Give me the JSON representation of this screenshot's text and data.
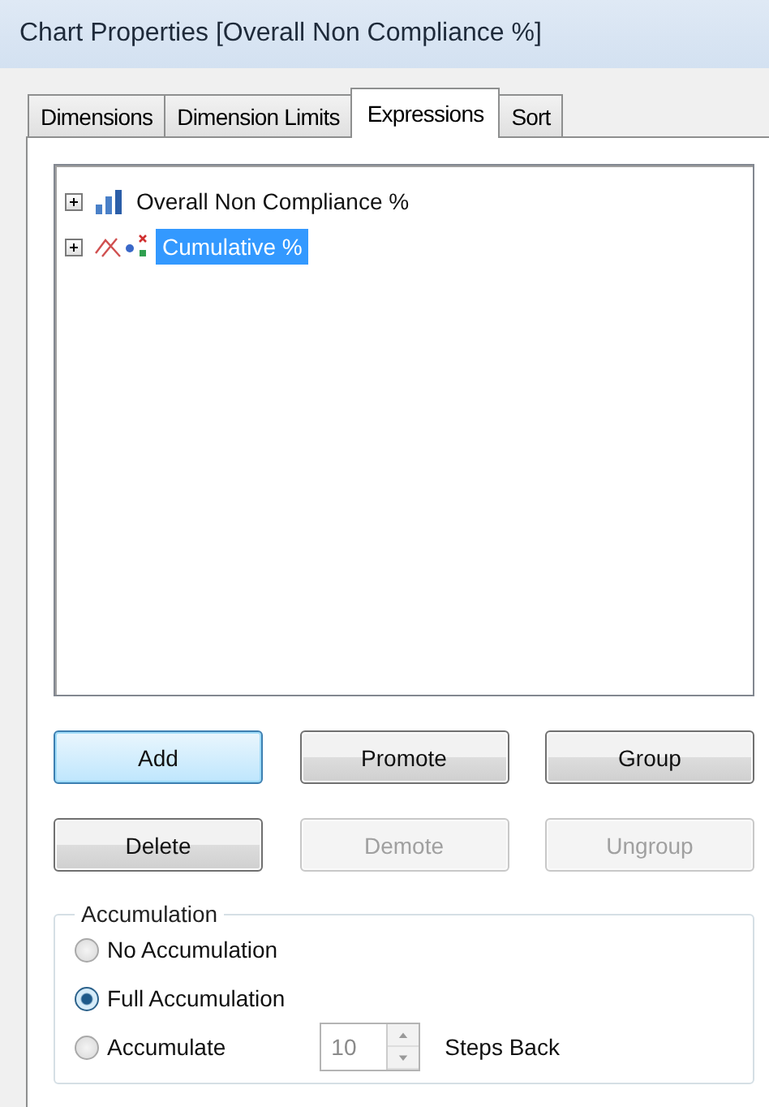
{
  "window": {
    "title": "Chart Properties [Overall Non Compliance %]"
  },
  "tabs": [
    {
      "label": "Dimensions",
      "selected": false
    },
    {
      "label": "Dimension Limits",
      "selected": false
    },
    {
      "label": "Expressions",
      "selected": true
    },
    {
      "label": "Sort",
      "selected": false
    }
  ],
  "expressions": [
    {
      "label": "Overall Non Compliance %",
      "kind": "bar",
      "expanded": false,
      "selected": false
    },
    {
      "label": "Cumulative %",
      "kind": "combo",
      "expanded": false,
      "selected": true
    }
  ],
  "buttons": [
    {
      "label": "Add",
      "disabled": false,
      "focused": true
    },
    {
      "label": "Promote",
      "disabled": false,
      "focused": false
    },
    {
      "label": "Group",
      "disabled": false,
      "focused": false
    },
    {
      "label": "Delete",
      "disabled": false,
      "focused": false
    },
    {
      "label": "Demote",
      "disabled": true,
      "focused": false
    },
    {
      "label": "Ungroup",
      "disabled": true,
      "focused": false
    }
  ],
  "accumulation": {
    "title": "Accumulation",
    "options": [
      {
        "label": "No Accumulation",
        "selected": false
      },
      {
        "label": "Full Accumulation",
        "selected": true
      },
      {
        "label": "Accumulate",
        "selected": false
      }
    ],
    "steps": {
      "value": "10",
      "disabled": true,
      "label": "Steps Back"
    }
  }
}
